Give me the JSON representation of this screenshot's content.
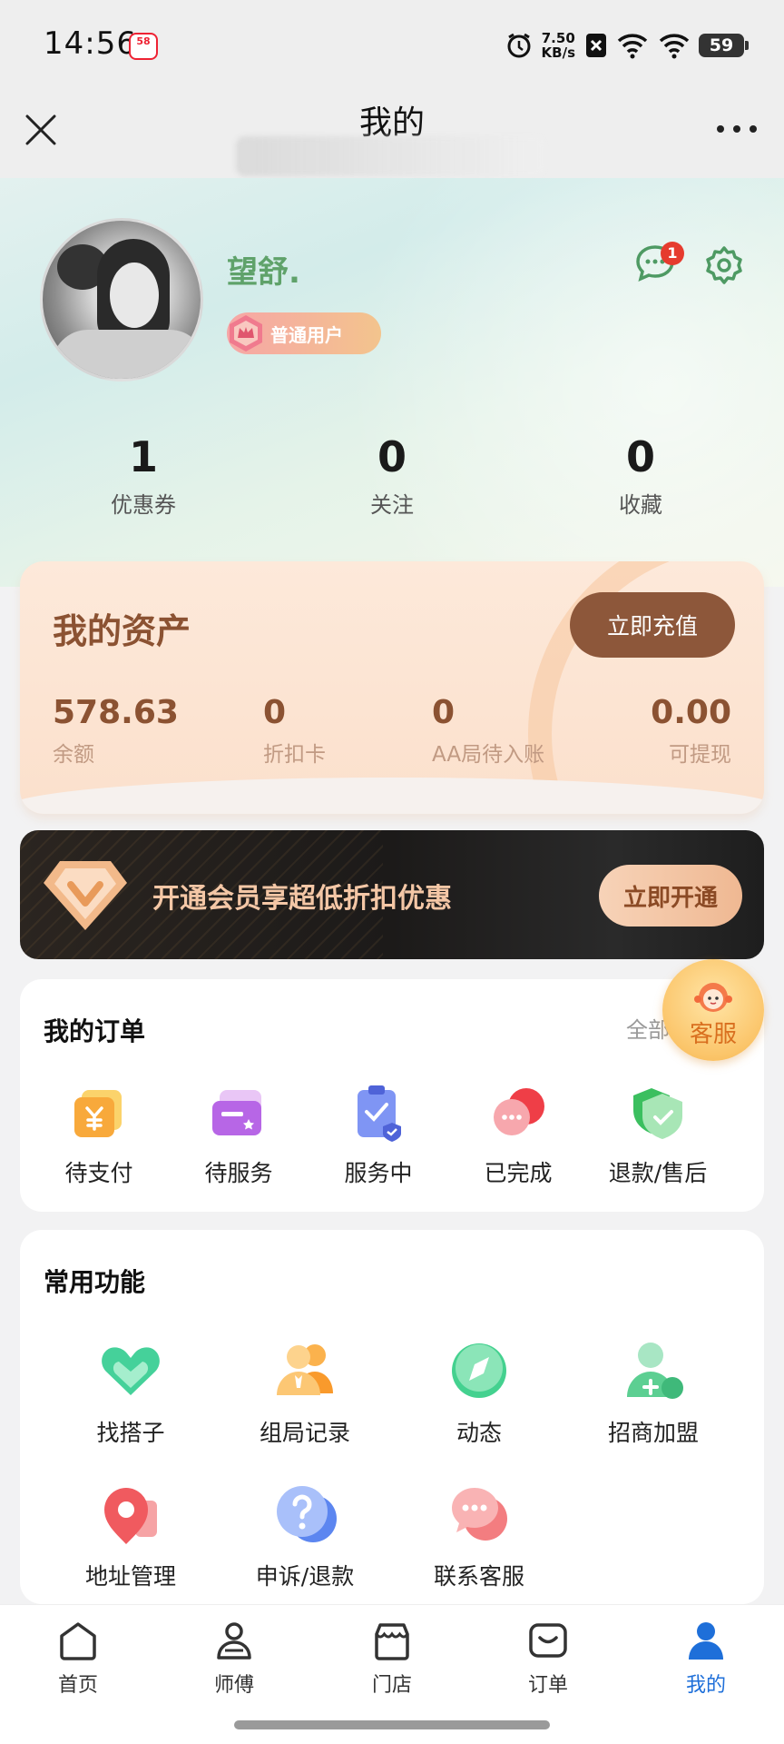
{
  "status_bar": {
    "time": "14:56",
    "app_logo_text": "58",
    "speed": "7.50",
    "speed_unit": "KB/s",
    "battery": "59"
  },
  "header": {
    "title": "我的"
  },
  "profile": {
    "username": "望舒.",
    "badge": "普通用户",
    "message_count": "1",
    "stats": [
      {
        "value": "1",
        "label": "优惠券"
      },
      {
        "value": "0",
        "label": "关注"
      },
      {
        "value": "0",
        "label": "收藏"
      }
    ]
  },
  "assets": {
    "title": "我的资产",
    "recharge_label": "立即充值",
    "items": [
      {
        "value": "578.63",
        "label": "余额"
      },
      {
        "value": "0",
        "label": "折扣卡"
      },
      {
        "value": "0",
        "label": "AA局待入账"
      },
      {
        "value": "0.00",
        "label": "可提现"
      }
    ]
  },
  "vip": {
    "text": "开通会员享超低折扣优惠",
    "button_label": "立即开通"
  },
  "orders": {
    "title": "我的订单",
    "all_label": "全部",
    "items": [
      {
        "label": "待支付",
        "icon": "yen-wallet-icon"
      },
      {
        "label": "待服务",
        "icon": "card-icon"
      },
      {
        "label": "服务中",
        "icon": "clipboard-check-icon"
      },
      {
        "label": "已完成",
        "icon": "chat-bubbles-icon"
      },
      {
        "label": "退款/售后",
        "icon": "shield-check-icon"
      }
    ]
  },
  "customer_service": {
    "label": "客服"
  },
  "functions": {
    "title": "常用功能",
    "items": [
      {
        "label": "找搭子",
        "icon": "handshake-icon"
      },
      {
        "label": "组局记录",
        "icon": "group-icon"
      },
      {
        "label": "动态",
        "icon": "compass-icon"
      },
      {
        "label": "招商加盟",
        "icon": "add-user-icon"
      },
      {
        "label": "地址管理",
        "icon": "location-icon"
      },
      {
        "label": "申诉/退款",
        "icon": "question-icon"
      },
      {
        "label": "联系客服",
        "icon": "chat-icon"
      }
    ]
  },
  "tabbar": {
    "items": [
      {
        "label": "首页",
        "icon": "home-icon"
      },
      {
        "label": "师傅",
        "icon": "worker-icon"
      },
      {
        "label": "门店",
        "icon": "store-icon"
      },
      {
        "label": "订单",
        "icon": "order-bag-icon"
      },
      {
        "label": "我的",
        "icon": "person-icon",
        "active": true
      }
    ]
  },
  "colors": {
    "accent": "#1e6fd9",
    "asset_brown": "#8b5232",
    "username_green": "#5fa26a"
  }
}
